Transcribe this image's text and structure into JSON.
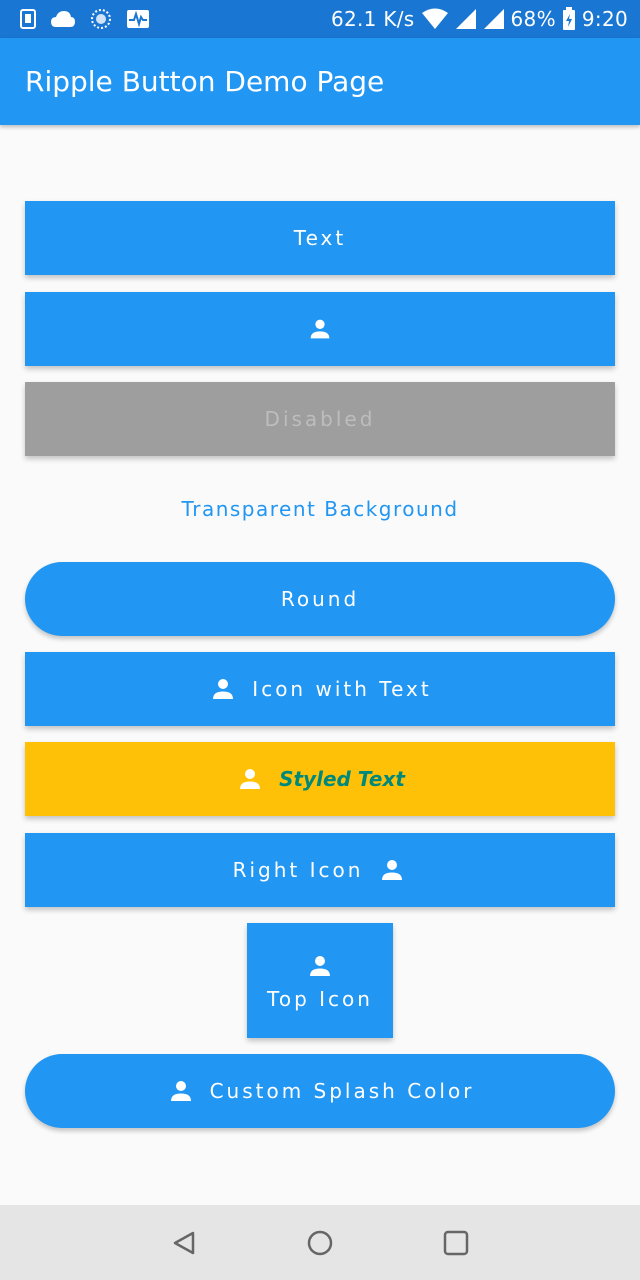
{
  "status_bar": {
    "speed": "62.1 K/s",
    "battery": "68%",
    "time": "9:20",
    "icons": [
      "sim-icon",
      "cloud-icon",
      "sync-icon",
      "activity-icon",
      "wifi-icon",
      "signal-icon",
      "signal-icon",
      "battery-charging-icon"
    ]
  },
  "app_bar": {
    "title": "Ripple Button Demo Page"
  },
  "buttons": {
    "text": "Text",
    "icon_only": "person-icon",
    "disabled": "Disabled",
    "transparent": "Transparent Background",
    "round": "Round",
    "icon_with_text": "Icon with Text",
    "styled_text": "Styled Text",
    "right_icon": "Right Icon",
    "top_icon": "Top Icon",
    "custom_splash": "Custom Splash Color"
  },
  "colors": {
    "primary": "#2196f3",
    "status_bar": "#1976d2",
    "disabled": "#9e9e9e",
    "styled_background": "#ffc107",
    "styled_text": "#00897b"
  },
  "nav_bar": {
    "icons": [
      "back-icon",
      "home-icon",
      "recents-icon"
    ]
  }
}
